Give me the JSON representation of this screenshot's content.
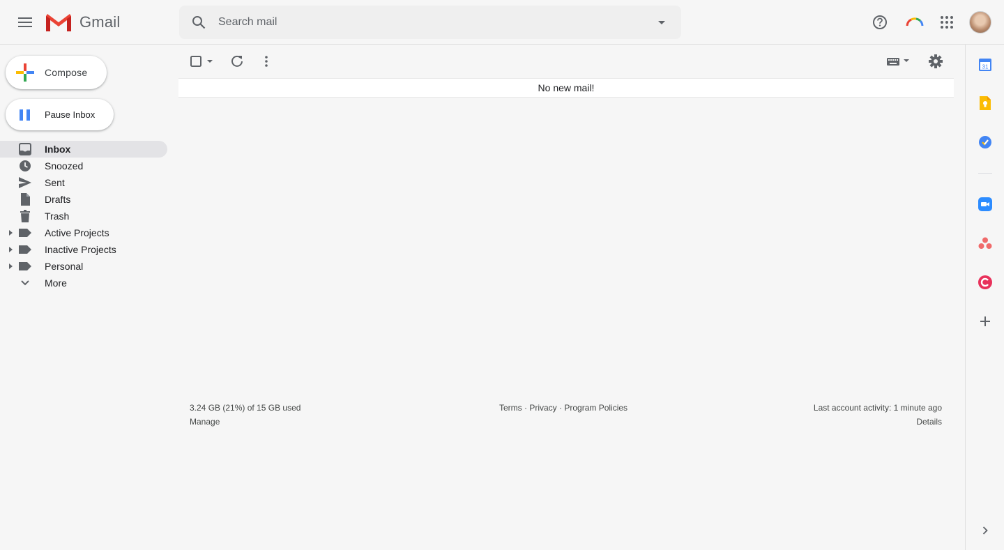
{
  "header": {
    "app_name": "Gmail",
    "search_placeholder": "Search mail"
  },
  "nav": {
    "compose_label": "Compose",
    "pause_label": "Pause Inbox",
    "items": [
      {
        "label": "Inbox",
        "icon": "inbox-icon",
        "active": true
      },
      {
        "label": "Snoozed",
        "icon": "clock-icon"
      },
      {
        "label": "Sent",
        "icon": "send-icon"
      },
      {
        "label": "Drafts",
        "icon": "draft-icon"
      },
      {
        "label": "Trash",
        "icon": "trash-icon"
      },
      {
        "label": "Active Projects",
        "icon": "label-icon",
        "expandable": true
      },
      {
        "label": "Inactive Projects",
        "icon": "label-icon",
        "expandable": true
      },
      {
        "label": "Personal",
        "icon": "label-icon",
        "expandable": true
      },
      {
        "label": "More",
        "icon": "chevron-down-icon"
      }
    ]
  },
  "main": {
    "empty_message": "No new mail!"
  },
  "footer": {
    "storage": "3.24 GB (21%) of 15 GB used",
    "storage_percent": 21,
    "manage": "Manage",
    "links": [
      "Terms",
      "Privacy",
      "Program Policies"
    ],
    "link_separator": " · ",
    "activity": "Last account activity: 1 minute ago",
    "details": "Details"
  },
  "side_panel": {
    "calendar_day": "31",
    "apps": [
      "calendar-icon",
      "keep-icon",
      "tasks-icon",
      "zoom-icon",
      "asana-icon",
      "pink-app-icon",
      "add-icon",
      "expand-icon"
    ]
  },
  "colors": {
    "gmail_red": "#ea4335",
    "blue": "#4285f4",
    "green": "#34a853",
    "yellow": "#fbbc04",
    "zoom_blue": "#2d8cff",
    "asana_coral": "#f06a6a",
    "pink_app": "#e8315b"
  }
}
